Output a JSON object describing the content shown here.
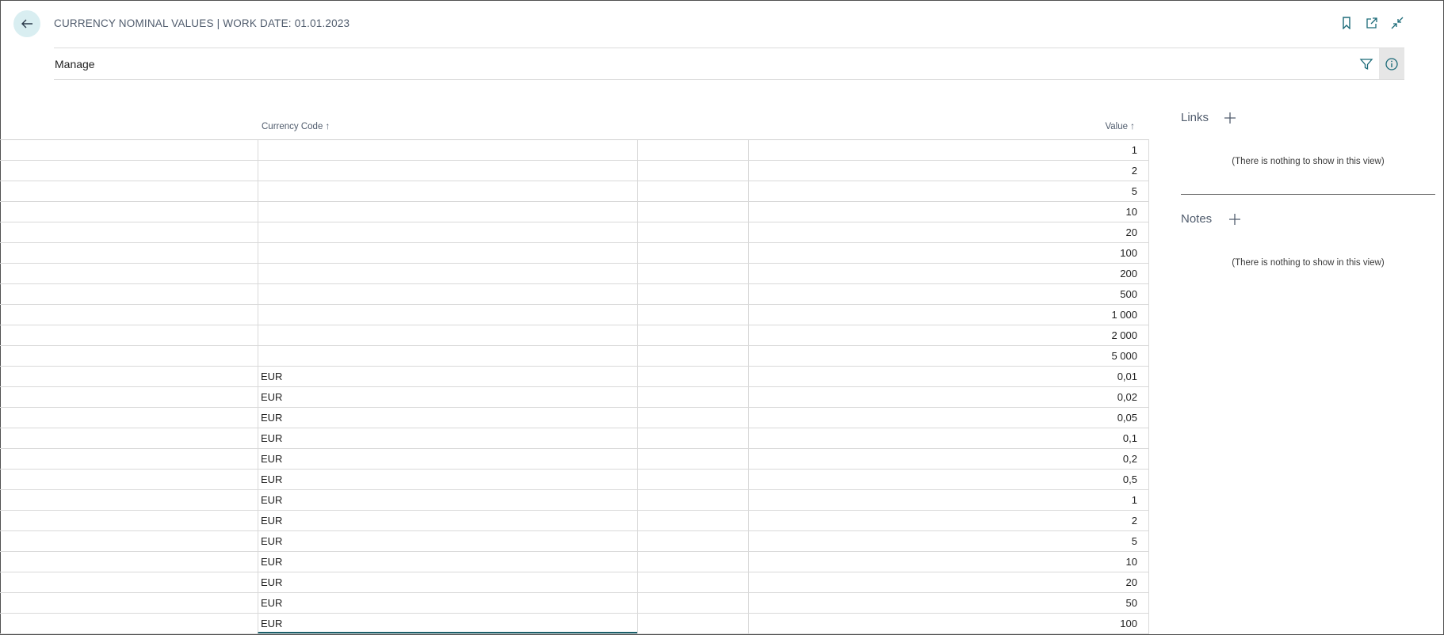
{
  "header": {
    "title": "CURRENCY NOMINAL VALUES | WORK DATE: 01.01.2023",
    "back_icon": "arrow-left-icon",
    "actions": [
      "bookmark-icon",
      "open-in-new-window-icon",
      "collapse-icon"
    ]
  },
  "action_bar": {
    "manage_label": "Manage",
    "filter_icon": "filter-icon",
    "info_icon": "info-icon"
  },
  "grid": {
    "columns": {
      "currency_code": "Currency Code",
      "value": "Value"
    },
    "sort_indicator": "↑",
    "rows": [
      {
        "currency": "",
        "value": "1"
      },
      {
        "currency": "",
        "value": "2"
      },
      {
        "currency": "",
        "value": "5"
      },
      {
        "currency": "",
        "value": "10"
      },
      {
        "currency": "",
        "value": "20"
      },
      {
        "currency": "",
        "value": "100"
      },
      {
        "currency": "",
        "value": "200"
      },
      {
        "currency": "",
        "value": "500"
      },
      {
        "currency": "",
        "value": "1 000"
      },
      {
        "currency": "",
        "value": "2 000"
      },
      {
        "currency": "",
        "value": "5 000"
      },
      {
        "currency": "EUR",
        "value": "0,01"
      },
      {
        "currency": "EUR",
        "value": "0,02"
      },
      {
        "currency": "EUR",
        "value": "0,05"
      },
      {
        "currency": "EUR",
        "value": "0,1"
      },
      {
        "currency": "EUR",
        "value": "0,2"
      },
      {
        "currency": "EUR",
        "value": "0,5"
      },
      {
        "currency": "EUR",
        "value": "1"
      },
      {
        "currency": "EUR",
        "value": "2"
      },
      {
        "currency": "EUR",
        "value": "5"
      },
      {
        "currency": "EUR",
        "value": "10"
      },
      {
        "currency": "EUR",
        "value": "20"
      },
      {
        "currency": "EUR",
        "value": "50"
      },
      {
        "currency": "EUR",
        "value": "100"
      }
    ]
  },
  "factbox": {
    "links": {
      "title": "Links",
      "empty_text": "(There is nothing to show in this view)"
    },
    "notes": {
      "title": "Notes",
      "empty_text": "(There is nothing to show in this view)"
    }
  },
  "colors": {
    "accent": "#1b6a78",
    "back_button_bg": "#d9eef1",
    "title_text": "#505c6d",
    "selected_underline": "#1b5f6a"
  }
}
